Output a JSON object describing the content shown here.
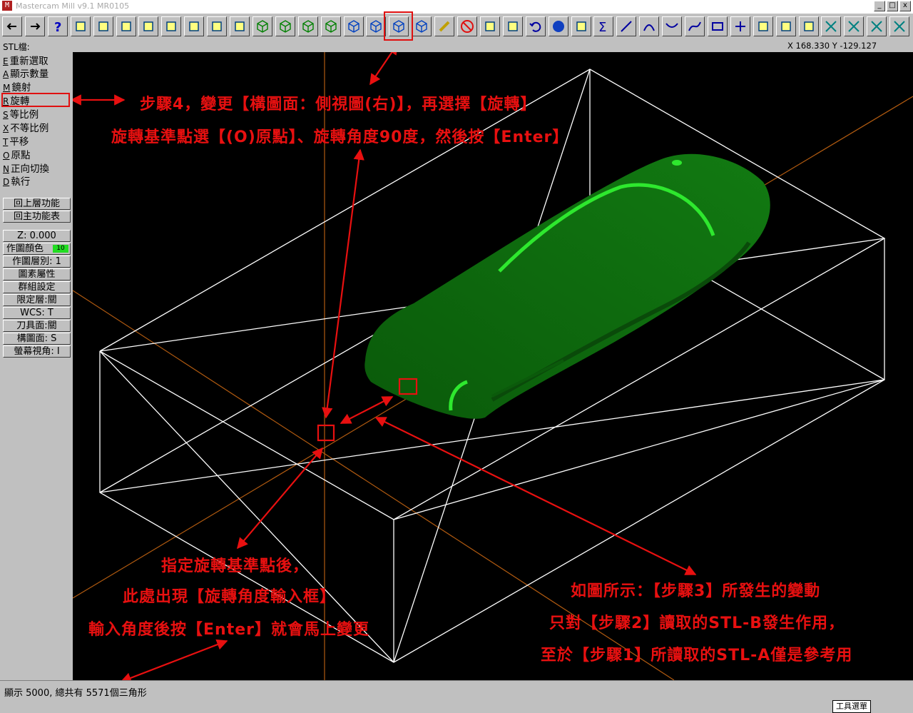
{
  "window": {
    "title": "Mastercam Mill v9.1 MR0105",
    "btn_min": "_",
    "btn_restore": "□",
    "btn_close": "x"
  },
  "status": {
    "prompt": "STL檔:",
    "coords": "X 168.330  Y -129.127"
  },
  "menu": {
    "items": [
      {
        "key": "E",
        "label": "重新選取"
      },
      {
        "key": "A",
        "label": "顯示數量"
      },
      {
        "key": "M",
        "label": "鏡射"
      },
      {
        "key": "R",
        "label": "旋轉"
      },
      {
        "key": "S",
        "label": "等比例"
      },
      {
        "key": "X",
        "label": "不等比例"
      },
      {
        "key": "T",
        "label": "平移"
      },
      {
        "key": "O",
        "label": "原點"
      },
      {
        "key": "N",
        "label": "正向切換"
      },
      {
        "key": "D",
        "label": "執行"
      }
    ],
    "back": "回上層功能",
    "main": "回主功能表",
    "settings": [
      "Z:  0.000",
      "作圖顏色",
      "作圖層別: 1",
      "圖素屬性",
      "群組設定",
      "限定層:關",
      "WCS:  T",
      "刀具面:關",
      "構圖面: S",
      "螢幕視角: I"
    ],
    "color_value": "10"
  },
  "annotations": {
    "step4_line1": "步驟4，變更【構圖面：側視圖(右)】，再選擇【旋轉】",
    "step4_line2": "旋轉基準點選【(O)原點】、旋轉角度90度，然後按【Enter】",
    "pivot_line1": "指定旋轉基準點後，",
    "pivot_line2": "此處出現【旋轉角度輸入框】",
    "pivot_line3": "輸入角度後按【Enter】就會馬上變更",
    "note_line1": "如圖所示：【步驟3】所發生的變動",
    "note_line2": "只對【步驟2】讀取的STL-B發生作用，",
    "note_line3": "至於【步驟1】所讀取的STL-A僅是參考用"
  },
  "bottom": {
    "message": "顯示 5000, 總共有 5571個三角形",
    "tag": "工具選單"
  },
  "colors": {
    "annotation": "#e81010",
    "model": "#0e6a0e",
    "highlight": "#2ee82e",
    "axis": "#b05a10",
    "box": "#ffffff"
  },
  "toolbar_icons": [
    "arrow-left-icon",
    "arrow-right-icon",
    "help-icon",
    "calculator-icon",
    "query-icon",
    "zoom-window-icon",
    "zoom-icon",
    "zoom-out-icon",
    "pan-icon",
    "select-icon",
    "redraw-icon",
    "view-iso-icon",
    "view-top-icon",
    "view-front-icon",
    "view-side-icon",
    "view-blue-1-icon",
    "view-blue-2-icon",
    "view-rotate-icon",
    "view-cube-icon",
    "pencil-icon",
    "delete-icon",
    "transform-1-icon",
    "transform-2-icon",
    "undo-icon",
    "sphere-icon",
    "grid-icon",
    "sum-icon",
    "line-icon",
    "arc-icon",
    "fillet-icon",
    "spline-icon",
    "rectangle-icon",
    "point-icon",
    "surface-icon",
    "solid-icon",
    "toolpath-icon",
    "trim-1-icon",
    "trim-2-icon",
    "trim-3-icon",
    "trim-4-icon"
  ]
}
